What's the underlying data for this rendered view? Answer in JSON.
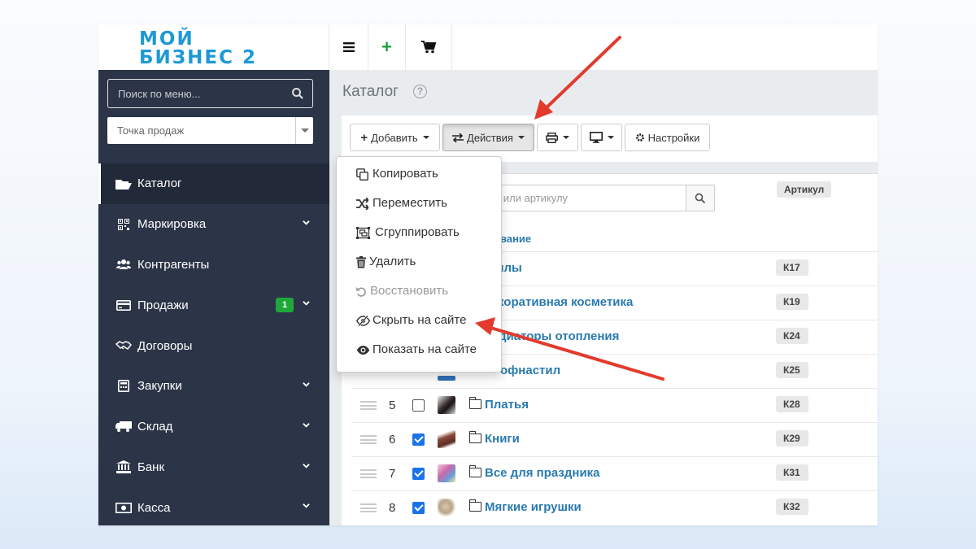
{
  "logo": {
    "line1": "МОЙ",
    "line2": "БИЗНЕС 2"
  },
  "topbar": {
    "menu_icon": "hamburger-icon",
    "add_icon": "plus-icon",
    "cart_icon": "cart-icon"
  },
  "sidebar": {
    "search_placeholder": "Поиск по меню...",
    "point_of_sale": "Точка продаж",
    "items": [
      {
        "label": "Каталог",
        "icon": "folder-open-icon",
        "active": true,
        "has_chevron": false
      },
      {
        "label": "Маркировка",
        "icon": "qr-code-icon",
        "has_chevron": true
      },
      {
        "label": "Контрагенты",
        "icon": "users-icon",
        "has_chevron": false
      },
      {
        "label": "Продажи",
        "icon": "card-icon",
        "badge": "1",
        "has_chevron": true
      },
      {
        "label": "Договоры",
        "icon": "handshake-icon",
        "has_chevron": false
      },
      {
        "label": "Закупки",
        "icon": "calculator-icon",
        "has_chevron": true
      },
      {
        "label": "Склад",
        "icon": "truck-icon",
        "has_chevron": true
      },
      {
        "label": "Банк",
        "icon": "bank-icon",
        "has_chevron": true
      },
      {
        "label": "Касса",
        "icon": "money-icon",
        "has_chevron": true
      }
    ]
  },
  "page": {
    "title": "Каталог",
    "help_icon": "question-circle-icon"
  },
  "toolbar": {
    "add_label": "Добавить",
    "actions_label": "Действия",
    "print_icon": "print-icon",
    "display_icon": "monitor-icon",
    "settings_label": "Настройки"
  },
  "table": {
    "search_placeholder": "нию или артикулу",
    "columns": {
      "name": "енование",
      "sku": "Артикул"
    },
    "rows": [
      {
        "num": "",
        "checked": false,
        "name": "ллы",
        "sku": "К17",
        "thumb": "#ffffff"
      },
      {
        "num": "",
        "checked": false,
        "name": "коративная косметика",
        "sku": "К19",
        "thumb": "#ffffff"
      },
      {
        "num": "",
        "checked": false,
        "name": "диаторы отопления",
        "sku": "К24",
        "thumb": "#ffffff"
      },
      {
        "num": "",
        "checked": false,
        "name": "офнастил",
        "sku": "К25",
        "thumb": "#2f6fb8"
      },
      {
        "num": "5",
        "checked": false,
        "name": "Платья",
        "sku": "К28",
        "thumb": "#3a3030"
      },
      {
        "num": "6",
        "checked": true,
        "name": "Книги",
        "sku": "К29",
        "thumb": "#8a4a3a"
      },
      {
        "num": "7",
        "checked": true,
        "name": "Все для праздника",
        "sku": "К31",
        "thumb": "#c86aa8"
      },
      {
        "num": "8",
        "checked": true,
        "name": "Мягкие игрушки",
        "sku": "К32",
        "thumb": "#b9a48a"
      }
    ]
  },
  "actions_menu": [
    {
      "label": "Копировать",
      "icon": "copy-icon",
      "disabled": false
    },
    {
      "label": "Переместить",
      "icon": "shuffle-icon",
      "disabled": false
    },
    {
      "label": "Сгруппировать",
      "icon": "group-icon",
      "disabled": false
    },
    {
      "label": "Удалить",
      "icon": "trash-icon",
      "disabled": false
    },
    {
      "label": "Восстановить",
      "icon": "undo-icon",
      "disabled": true
    },
    {
      "label": "Скрыть на сайте",
      "icon": "eye-slash-icon",
      "disabled": false
    },
    {
      "label": "Показать на сайте",
      "icon": "eye-icon",
      "disabled": false
    }
  ],
  "colors": {
    "sidebar_bg": "#2c3547",
    "link": "#2a7ab0",
    "annotation_arrow": "#e23b2e",
    "badge": "#1fa83a"
  }
}
